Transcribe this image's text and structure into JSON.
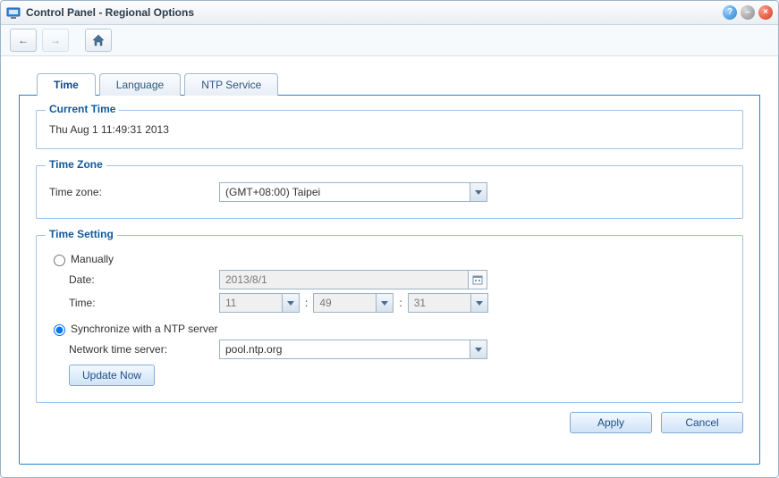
{
  "window": {
    "title": "Control Panel - Regional Options"
  },
  "tabs": {
    "time": "Time",
    "language": "Language",
    "ntp": "NTP Service"
  },
  "group_current_time": {
    "legend": "Current Time",
    "value": "Thu Aug 1 11:49:31 2013"
  },
  "group_timezone": {
    "legend": "Time Zone",
    "label": "Time zone:",
    "value": "(GMT+08:00) Taipei"
  },
  "group_timesetting": {
    "legend": "Time Setting",
    "manual_label": "Manually",
    "date_label": "Date:",
    "date_value": "2013/8/1",
    "time_label": "Time:",
    "hour": "11",
    "minute": "49",
    "second": "31",
    "sep": ":",
    "ntp_label": "Synchronize with a NTP server",
    "server_label": "Network time server:",
    "server_value": "pool.ntp.org",
    "update_now": "Update Now"
  },
  "footer": {
    "apply": "Apply",
    "cancel": "Cancel"
  }
}
